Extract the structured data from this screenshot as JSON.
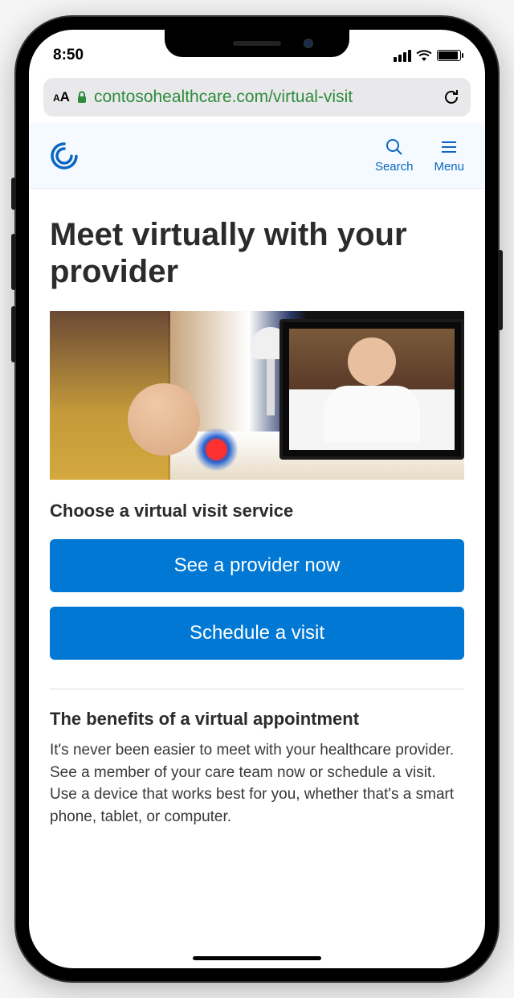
{
  "status_bar": {
    "time": "8:50"
  },
  "address_bar": {
    "url": "contosohealthcare.com/virtual-visit"
  },
  "site_header": {
    "search_label": "Search",
    "menu_label": "Menu"
  },
  "page": {
    "title": "Meet virtually with your provider",
    "choose_service_heading": "Choose a virtual visit service",
    "see_provider_button": "See a provider now",
    "schedule_visit_button": "Schedule a visit",
    "benefits_heading": "The benefits of a virtual appointment",
    "benefits_body": "It's never been easier to meet with your healthcare provider. See a member of your care team now or schedule a visit. Use a device that works best for you, whether that's a smart phone, tablet, or computer."
  }
}
